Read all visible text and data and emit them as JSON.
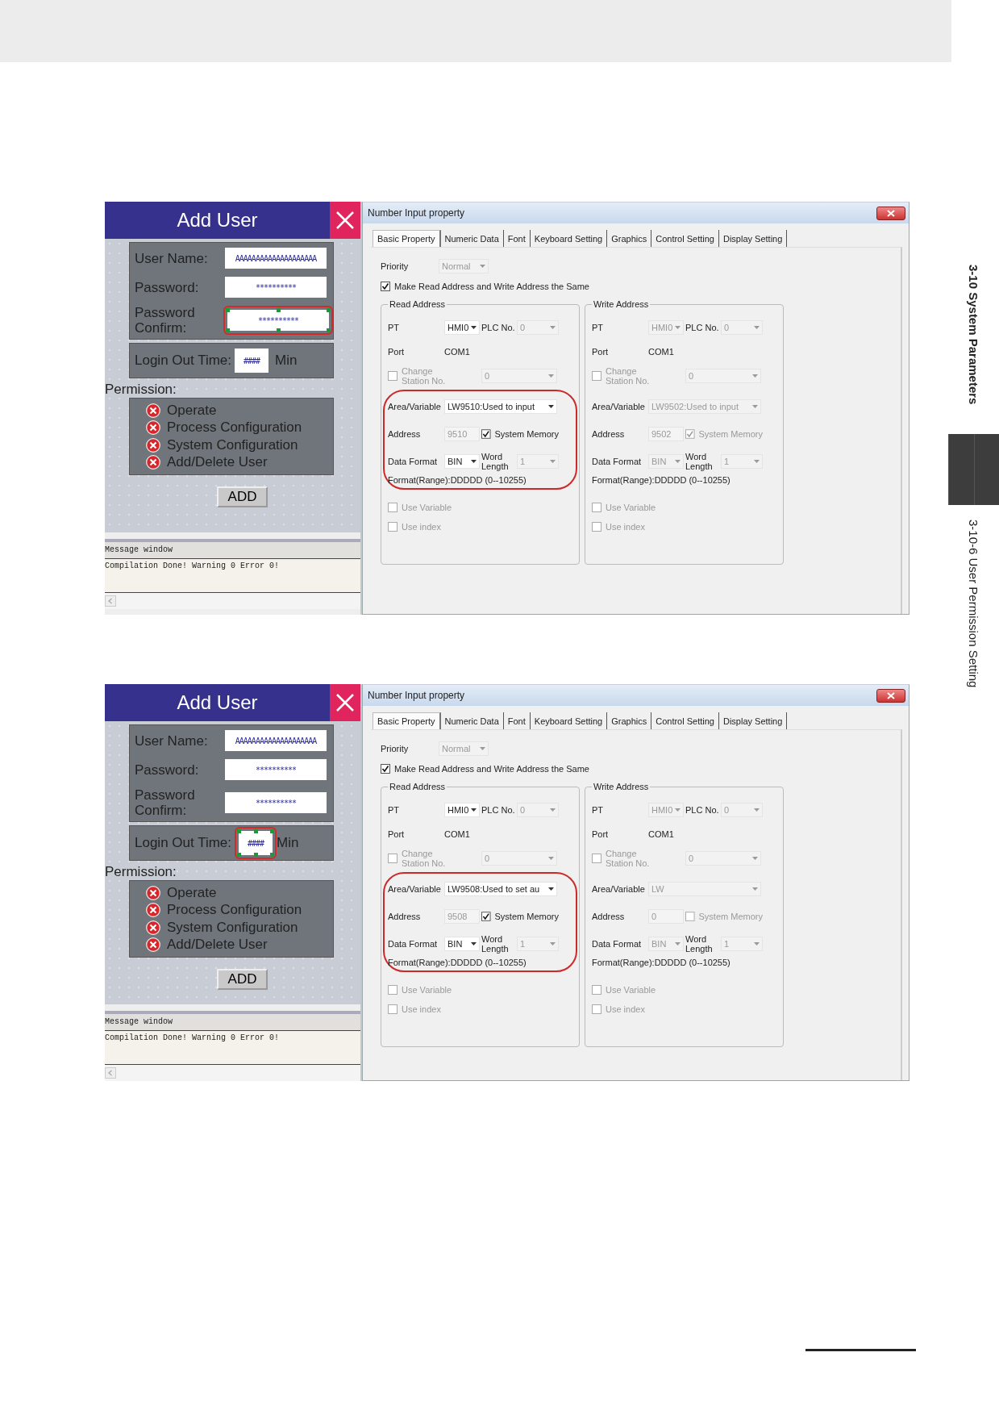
{
  "side_tab": {
    "chapter": "3-10 System Parameters",
    "section": "3-10-6  User Permission Setting"
  },
  "figures": [
    {
      "add_user": {
        "title": "Add User",
        "fields": [
          {
            "label": "User Name:",
            "value": "AAAAAAAAAAAAAAAAAAAA",
            "highlighted": false
          },
          {
            "label": "Password:",
            "value": "**********",
            "highlighted": false
          },
          {
            "label": "Password Confirm:",
            "value": "**********",
            "highlighted": true
          }
        ],
        "login": {
          "label": "Login Out Time:",
          "value": "####",
          "unit": "Min",
          "highlighted": false
        },
        "permission_label": "Permission:",
        "permissions": [
          "Operate",
          "Process Configuration",
          "System Configuration",
          "Add/Delete User"
        ],
        "add_button": "ADD",
        "message_window": {
          "title": "Message window",
          "text": "Compilation Done! Warning 0 Error 0!"
        }
      },
      "dialog": {
        "title": "Number Input property",
        "tabs": [
          {
            "label": "Basic Property",
            "selected": true
          },
          {
            "label": "Numeric Data",
            "selected": false
          },
          {
            "label": "Font",
            "selected": false
          },
          {
            "label": "Keyboard Setting",
            "selected": false
          },
          {
            "label": "Graphics",
            "selected": false
          },
          {
            "label": "Control Setting",
            "selected": false
          },
          {
            "label": "Display Setting",
            "selected": false
          }
        ],
        "priority": {
          "label": "Priority",
          "value": "Normal",
          "disabled": true
        },
        "same_address": {
          "label": "Make Read Address and Write Address the Same",
          "checked": true
        },
        "groups": [
          {
            "legend": "Read Address",
            "highlighted": true,
            "pt": {
              "label": "PT",
              "value": "HMI0",
              "disabled": false
            },
            "plc": {
              "label": "PLC No.",
              "value": "0",
              "disabled": true
            },
            "port": {
              "label": "Port",
              "value": "COM1"
            },
            "change_station": {
              "label": "Change Station No.",
              "checked": false,
              "value": "0",
              "disabled": true
            },
            "area": {
              "label": "Area/Variable",
              "value": "LW9510:Used to input",
              "disabled": false
            },
            "address": {
              "label": "Address",
              "value": "9510",
              "disabled": true
            },
            "system_memory": {
              "label": "System Memory",
              "checked": true,
              "disabled": false
            },
            "data_format": {
              "label": "Data Format",
              "value": "BIN",
              "disabled": false
            },
            "word_length": {
              "label": "Word Length",
              "value": "1",
              "disabled": true
            },
            "format_range": "Format(Range):DDDDD (0--10255)",
            "use_variable": {
              "label": "Use Variable",
              "checked": false
            },
            "use_index": {
              "label": "Use index",
              "checked": false
            }
          },
          {
            "legend": "Write Address",
            "highlighted": false,
            "pt": {
              "label": "PT",
              "value": "HMI0",
              "disabled": true
            },
            "plc": {
              "label": "PLC No.",
              "value": "0",
              "disabled": true
            },
            "port": {
              "label": "Port",
              "value": "COM1"
            },
            "change_station": {
              "label": "Change Station No.",
              "checked": false,
              "value": "0",
              "disabled": true
            },
            "area": {
              "label": "Area/Variable",
              "value": "LW9502:Used to input",
              "disabled": true
            },
            "address": {
              "label": "Address",
              "value": "9502",
              "disabled": true
            },
            "system_memory": {
              "label": "System Memory",
              "checked": true,
              "disabled": true
            },
            "data_format": {
              "label": "Data Format",
              "value": "BIN",
              "disabled": true
            },
            "word_length": {
              "label": "Word Length",
              "value": "1",
              "disabled": true
            },
            "format_range": "Format(Range):DDDDD (0--10255)",
            "use_variable": {
              "label": "Use Variable",
              "checked": false
            },
            "use_index": {
              "label": "Use index",
              "checked": false
            }
          }
        ]
      }
    },
    {
      "add_user": {
        "title": "Add User",
        "fields": [
          {
            "label": "User Name:",
            "value": "AAAAAAAAAAAAAAAAAAAA",
            "highlighted": false
          },
          {
            "label": "Password:",
            "value": "**********",
            "highlighted": false
          },
          {
            "label": "Password Confirm:",
            "value": "**********",
            "highlighted": false
          }
        ],
        "login": {
          "label": "Login Out Time:",
          "value": "####",
          "unit": "Min",
          "highlighted": true
        },
        "permission_label": "Permission:",
        "permissions": [
          "Operate",
          "Process Configuration",
          "System Configuration",
          "Add/Delete User"
        ],
        "add_button": "ADD",
        "message_window": {
          "title": "Message window",
          "text": "Compilation Done! Warning 0 Error 0!"
        }
      },
      "dialog": {
        "title": "Number Input property",
        "tabs": [
          {
            "label": "Basic Property",
            "selected": true
          },
          {
            "label": "Numeric Data",
            "selected": false
          },
          {
            "label": "Font",
            "selected": false
          },
          {
            "label": "Keyboard Setting",
            "selected": false
          },
          {
            "label": "Graphics",
            "selected": false
          },
          {
            "label": "Control Setting",
            "selected": false
          },
          {
            "label": "Display Setting",
            "selected": false
          }
        ],
        "priority": {
          "label": "Priority",
          "value": "Normal",
          "disabled": true
        },
        "same_address": {
          "label": "Make Read Address and Write Address the Same",
          "checked": true
        },
        "groups": [
          {
            "legend": "Read Address",
            "highlighted": true,
            "pt": {
              "label": "PT",
              "value": "HMI0",
              "disabled": false
            },
            "plc": {
              "label": "PLC No.",
              "value": "0",
              "disabled": true
            },
            "port": {
              "label": "Port",
              "value": "COM1"
            },
            "change_station": {
              "label": "Change Station No.",
              "checked": false,
              "value": "0",
              "disabled": true
            },
            "area": {
              "label": "Area/Variable",
              "value": "LW9508:Used to set au",
              "disabled": false
            },
            "address": {
              "label": "Address",
              "value": "9508",
              "disabled": true
            },
            "system_memory": {
              "label": "System Memory",
              "checked": true,
              "disabled": false
            },
            "data_format": {
              "label": "Data Format",
              "value": "BIN",
              "disabled": false
            },
            "word_length": {
              "label": "Word Length",
              "value": "1",
              "disabled": true
            },
            "format_range": "Format(Range):DDDDD (0--10255)",
            "use_variable": {
              "label": "Use Variable",
              "checked": false
            },
            "use_index": {
              "label": "Use index",
              "checked": false
            }
          },
          {
            "legend": "Write Address",
            "highlighted": false,
            "pt": {
              "label": "PT",
              "value": "HMI0",
              "disabled": true
            },
            "plc": {
              "label": "PLC No.",
              "value": "0",
              "disabled": true
            },
            "port": {
              "label": "Port",
              "value": "COM1"
            },
            "change_station": {
              "label": "Change Station No.",
              "checked": false,
              "value": "0",
              "disabled": true
            },
            "area": {
              "label": "Area/Variable",
              "value": "LW",
              "disabled": true
            },
            "address": {
              "label": "Address",
              "value": "0",
              "disabled": true
            },
            "system_memory": {
              "label": "System Memory",
              "checked": false,
              "disabled": true
            },
            "data_format": {
              "label": "Data Format",
              "value": "BIN",
              "disabled": true
            },
            "word_length": {
              "label": "Word Length",
              "value": "1",
              "disabled": true
            },
            "format_range": "Format(Range):DDDDD (0--10255)",
            "use_variable": {
              "label": "Use Variable",
              "checked": false
            },
            "use_index": {
              "label": "Use index",
              "checked": false
            }
          }
        ]
      }
    }
  ]
}
